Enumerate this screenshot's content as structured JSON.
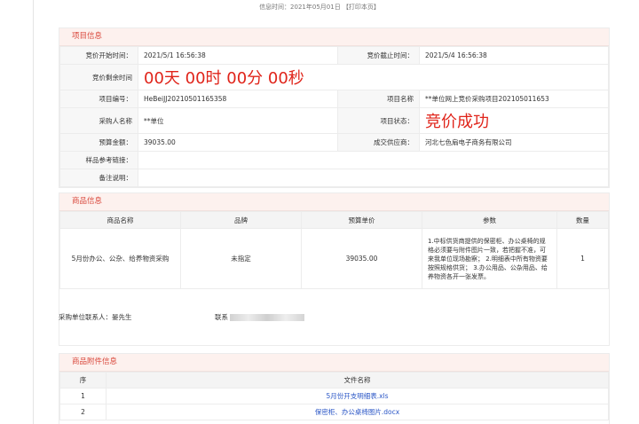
{
  "header": {
    "info_time": "信息时间：2021年05月01日",
    "print_link": "【打印本页】"
  },
  "project": {
    "title": "项目信息",
    "start_label": "竞价开始时间：",
    "start_value": "2021/5/1 16:56:38",
    "end_label": "竞价截止时间：",
    "end_value": "2021/5/4 16:56:38",
    "remaining_label": "竞价剩余时间",
    "remaining_value": "00天 00时 00分 00秒",
    "code_label": "项目编号：",
    "code_value": "HeBeiJJ20210501165358",
    "name_label": "项目名称",
    "name_value": "**单位网上竞价采购项目202105011653",
    "buyer_label": "采购人名称",
    "buyer_value": "**单位",
    "status_label": "项目状态：",
    "status_value": "竞价成功",
    "budget_label": "预算金额：",
    "budget_value": "39035.00",
    "supplier_label": "成交供应商：",
    "supplier_value": "河北七色扇电子商务有限公司",
    "sample_label": "样品参考链接：",
    "sample_value": "",
    "remark_label": "备注说明：",
    "remark_value": ""
  },
  "goods": {
    "title": "商品信息",
    "columns": [
      "商品名称",
      "品牌",
      "预算单价",
      "参数",
      "数量"
    ],
    "rows": [
      {
        "name": "5月份办公、公杂、给养物资采购",
        "brand": "未指定",
        "price": "39035.00",
        "params": "1.中标供货商提供的保密柜、办公桌椅的规格必须要与附件图片一致，若把握不准，可来我单位现场勘察； 2.明细表中所有物资要按照规格供货； 3.办公用品、公杂用品、给养物资各开一张发票。",
        "qty": "1"
      }
    ]
  },
  "contact": {
    "person": "采购单位联系人：晏先生",
    "phone_label": "联系"
  },
  "attachments": {
    "title": "商品附件信息",
    "columns": [
      "序",
      "文件名称"
    ],
    "rows": [
      {
        "no": "1",
        "file": "5月份开支明细表.xls"
      },
      {
        "no": "2",
        "file": "保密柜、办公桌椅图片.docx"
      }
    ]
  },
  "colors": {
    "accent_red": "#e0241a",
    "panel_header_bg": "#fdf1ee",
    "link_blue": "#2a56c6"
  }
}
